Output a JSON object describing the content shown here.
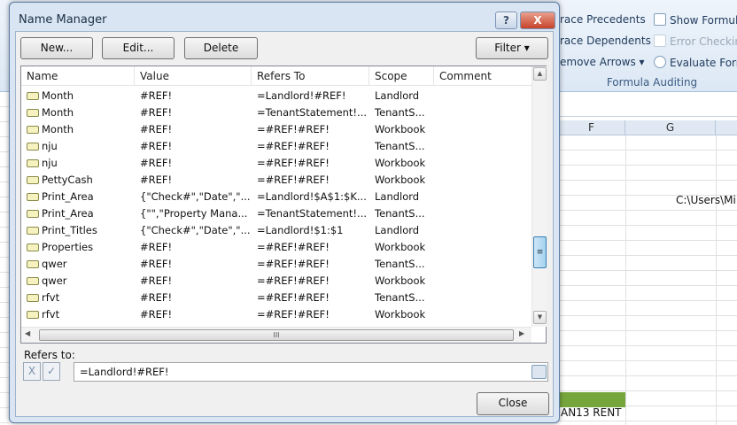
{
  "ribbon": {
    "items": [
      {
        "label": "race Precedents",
        "icon": "trace-precedents-icon"
      },
      {
        "label": "race Dependents",
        "icon": "trace-dependents-icon"
      },
      {
        "label": "emove Arrows ▾",
        "icon": "remove-arrows-icon"
      },
      {
        "label": "Show Formul",
        "icon": "show-formulas-icon"
      },
      {
        "label": "Error Checkin",
        "icon": "error-checking-icon"
      },
      {
        "label": "Evaluate Form",
        "icon": "evaluate-formula-icon"
      }
    ],
    "group": "Formula Auditing"
  },
  "sheet": {
    "columns": [
      "F",
      "G"
    ],
    "cell_g": "C:\\Users\\Mi",
    "cell_bottom": "AN13 RENT"
  },
  "dialog": {
    "title": "Name Manager",
    "help": "?",
    "close_x": "X",
    "buttons": {
      "new": "New...",
      "edit": "Edit...",
      "delete": "Delete",
      "filter": "Filter ▾"
    },
    "columns": [
      "Name",
      "Value",
      "Refers To",
      "Scope",
      "Comment"
    ],
    "rows": [
      {
        "name": "Month",
        "value": "#REF!",
        "refers": "=Landlord!#REF!",
        "scope": "Landlord",
        "comment": ""
      },
      {
        "name": "Month",
        "value": "#REF!",
        "refers": "=TenantStatement!...",
        "scope": "TenantS...",
        "comment": ""
      },
      {
        "name": "Month",
        "value": "#REF!",
        "refers": "=#REF!#REF!",
        "scope": "Workbook",
        "comment": ""
      },
      {
        "name": "nju",
        "value": "#REF!",
        "refers": "=#REF!#REF!",
        "scope": "TenantS...",
        "comment": ""
      },
      {
        "name": "nju",
        "value": "#REF!",
        "refers": "=#REF!#REF!",
        "scope": "Workbook",
        "comment": ""
      },
      {
        "name": "PettyCash",
        "value": "#REF!",
        "refers": "=#REF!#REF!",
        "scope": "Workbook",
        "comment": ""
      },
      {
        "name": "Print_Area",
        "value": "{\"Check#\",\"Date\",\"...",
        "refers": "=Landlord!$A$1:$K...",
        "scope": "Landlord",
        "comment": ""
      },
      {
        "name": "Print_Area",
        "value": "{\"\",\"Property Mana...",
        "refers": "=TenantStatement!...",
        "scope": "TenantS...",
        "comment": ""
      },
      {
        "name": "Print_Titles",
        "value": "{\"Check#\",\"Date\",\"...",
        "refers": "=Landlord!$1:$1",
        "scope": "Landlord",
        "comment": ""
      },
      {
        "name": "Properties",
        "value": "#REF!",
        "refers": "=#REF!#REF!",
        "scope": "Workbook",
        "comment": ""
      },
      {
        "name": "qwer",
        "value": "#REF!",
        "refers": "=#REF!#REF!",
        "scope": "TenantS...",
        "comment": ""
      },
      {
        "name": "qwer",
        "value": "#REF!",
        "refers": "=#REF!#REF!",
        "scope": "Workbook",
        "comment": ""
      },
      {
        "name": "rfvt",
        "value": "#REF!",
        "refers": "=#REF!#REF!",
        "scope": "TenantS...",
        "comment": ""
      },
      {
        "name": "rfvt",
        "value": "#REF!",
        "refers": "=#REF!#REF!",
        "scope": "Workbook",
        "comment": ""
      }
    ],
    "refers_label": "Refers to:",
    "refers_value": "=Landlord!#REF!",
    "cancel_glyph": "X",
    "confirm_glyph": "✓",
    "close": "Close",
    "scroll_grip": "≡",
    "hgrip": "III"
  }
}
